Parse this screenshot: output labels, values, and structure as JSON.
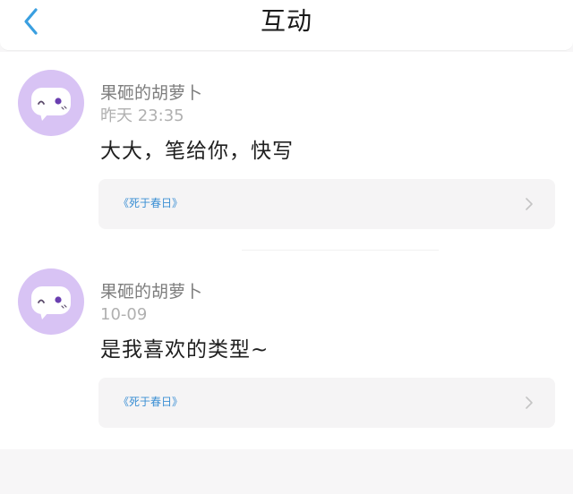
{
  "header": {
    "title": "互动"
  },
  "items": [
    {
      "username": "果砸的胡萝卜",
      "time": "昨天 23:35",
      "content": "大大，笔给你，快写",
      "work_title": "《死于春日》"
    },
    {
      "username": "果砸的胡萝卜",
      "time": "10-09",
      "content": "是我喜欢的类型~",
      "work_title": "《死于春日》"
    }
  ],
  "icons": {
    "back": "back-arrow-icon",
    "avatar": "mascot-avatar-icon",
    "chevron": "chevron-right-icon"
  },
  "colors": {
    "accent": "#3a9fe0",
    "avatar_bg": "#d8c3f4",
    "link": "#3b8fd4"
  }
}
